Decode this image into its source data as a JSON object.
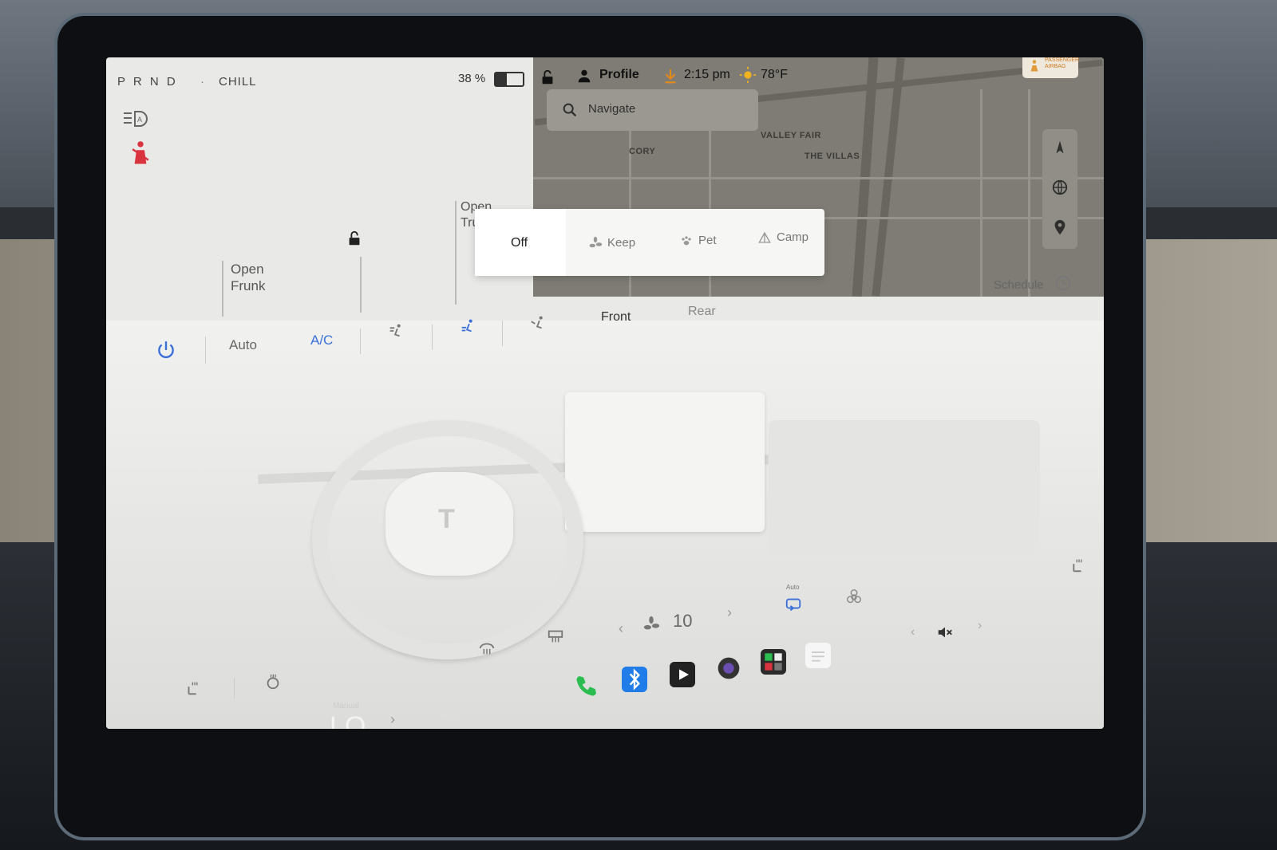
{
  "status": {
    "gear": "P R N D",
    "drive_mode": "CHILL",
    "battery": "38 %",
    "profile": "Profile",
    "time": "2:15 pm",
    "temperature": "78°F",
    "airbag": "PASSENGER AIRBAG"
  },
  "search": {
    "placeholder": "Navigate"
  },
  "map_labels": [
    "CORY",
    "VALLEY FAIR",
    "THE VILLAS"
  ],
  "car": {
    "open_frunk_line1": "Open",
    "open_frunk_line2": "Frunk",
    "open_trunk_line1": "Open",
    "open_trunk_line2": "Trunk"
  },
  "climate_mode_popup": {
    "options": [
      "Off",
      "Keep",
      "Pet",
      "Camp"
    ],
    "selected": "Off"
  },
  "climate": {
    "auto": "Auto",
    "ac": "A/C",
    "front": "Front",
    "rear": "Rear",
    "schedule": "Schedule",
    "fan_speed": "10",
    "recirc_auto": "Auto"
  },
  "dock": {
    "temp_mode": "Manual",
    "temp_value": "LO"
  },
  "colors": {
    "accent": "#3a6fd8",
    "seatbelt_warning": "#d9333f",
    "phone": "#2bbd4f",
    "bluetooth": "#1f7ce8"
  }
}
